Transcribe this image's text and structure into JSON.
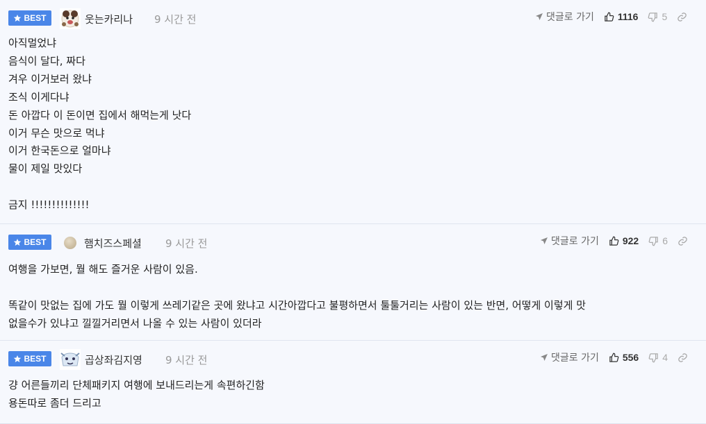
{
  "comments": [
    {
      "badge": "BEST",
      "nickname": "웃는카리나",
      "time": "9 시간 전",
      "reply_label": "댓글로 가기",
      "likes": "1116",
      "dislikes": "5",
      "body_lines": [
        "아직멀었냐",
        "음식이 달다, 짜다",
        "겨우 이거보러 왔냐",
        "조식 이게다냐",
        "돈 아깝다 이 돈이면 집에서 해먹는게 낫다",
        "이거 무슨 맛으로 먹냐",
        "이거 한국돈으로 얼마냐",
        "물이 제일 맛있다",
        "",
        "금지 !!!!!!!!!!!!!!"
      ]
    },
    {
      "badge": "BEST",
      "nickname": "햄치즈스페셜",
      "time": "9 시간 전",
      "reply_label": "댓글로 가기",
      "likes": "922",
      "dislikes": "6",
      "body_lines": [
        "여행을 가보면, 뭘 해도 즐거운 사람이 있음.",
        "",
        "똑같이 맛없는 집에 가도 뭘 이렇게 쓰레기같은 곳에 왔냐고 시간아깝다고 불평하면서 툴툴거리는 사람이 있는 반면, 어떻게 이렇게 맛",
        "없을수가 있냐고 낄낄거리면서 나올 수 있는 사람이 있더라"
      ]
    },
    {
      "badge": "BEST",
      "nickname": "곱상좌김지영",
      "time": "9 시간 전",
      "reply_label": "댓글로 가기",
      "likes": "556",
      "dislikes": "4",
      "body_lines": [
        "걍 어른들끼리 단체패키지 여행에 보내드리는게 속편하긴함",
        "용돈따로 좀더 드리고"
      ]
    }
  ]
}
